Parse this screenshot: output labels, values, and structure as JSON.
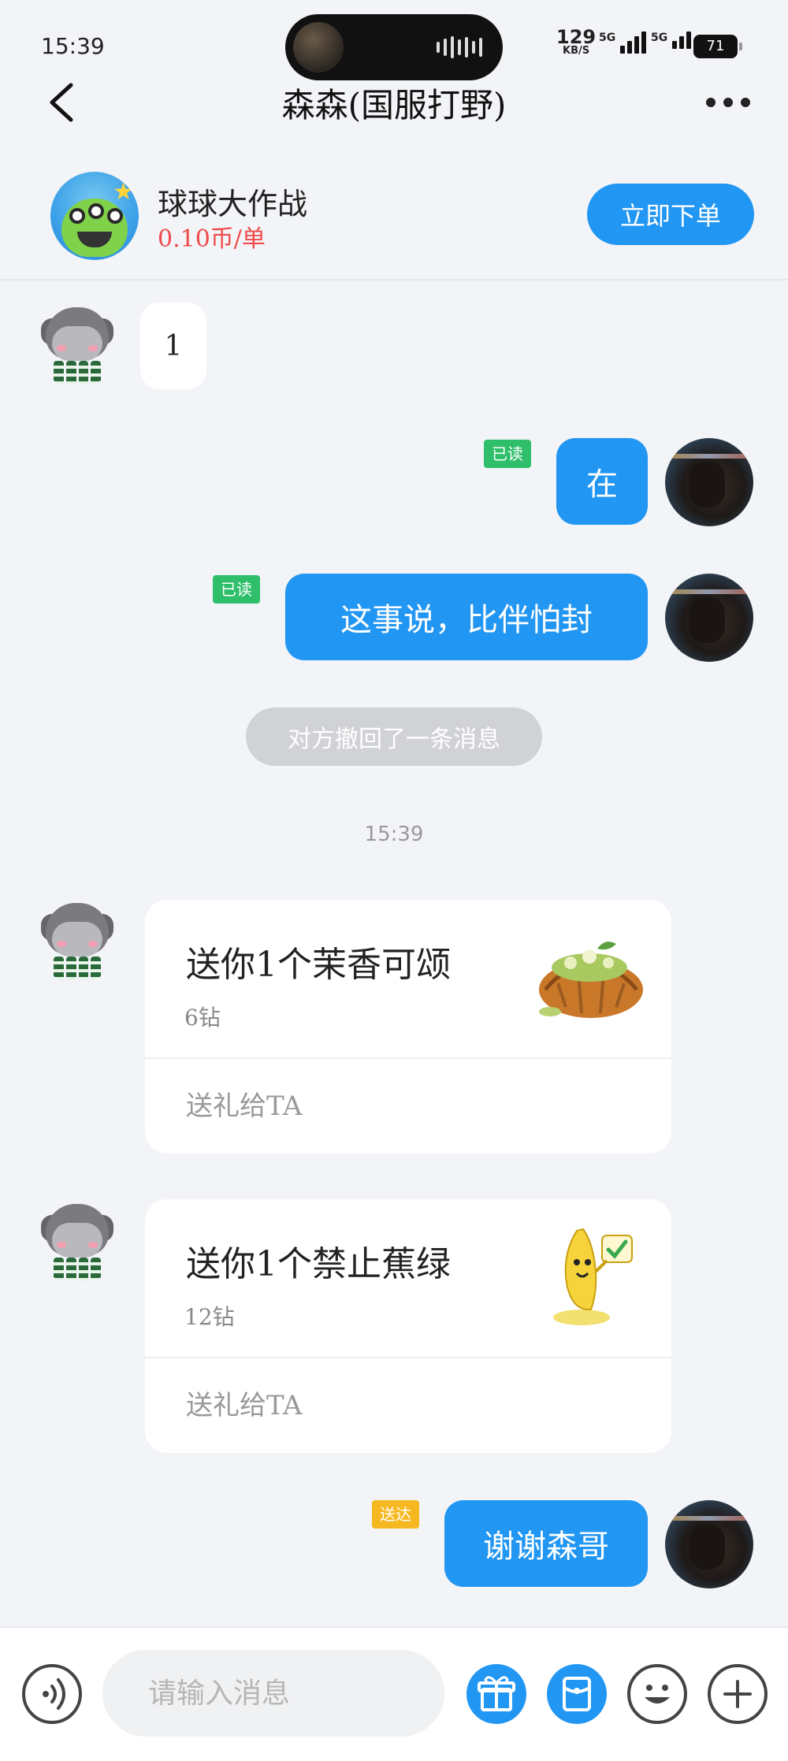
{
  "status_bar": {
    "time": "15:39",
    "net_speed": "129",
    "net_unit": "KB/S",
    "signal1_label": "5G",
    "signal2_label": "5G",
    "battery": "71"
  },
  "header": {
    "title": "森森(国服打野)"
  },
  "service": {
    "game_name": "球球大作战",
    "price": "0.10币/单",
    "order_button": "立即下单"
  },
  "messages": {
    "m1_text": "1",
    "m2_text": "在",
    "m2_status": "已读",
    "m3_text": "这事说，比伴怕封",
    "m3_status": "已读",
    "recall_notice": "对方撤回了一条消息",
    "timestamp": "15:39",
    "gift1": {
      "title": "送你1个茉香可颂",
      "price": "6钻",
      "action": "送礼给TA"
    },
    "gift2": {
      "title": "送你1个禁止蕉绿",
      "price": "12钻",
      "action": "送礼给TA"
    },
    "m4_text": "谢谢森哥",
    "m4_status": "送达"
  },
  "input": {
    "placeholder": "请输入消息"
  },
  "colors": {
    "accent": "#2196f3",
    "read_tag": "#2fbf6a",
    "sent_tag": "#f6b820",
    "price": "#f04a4a"
  }
}
